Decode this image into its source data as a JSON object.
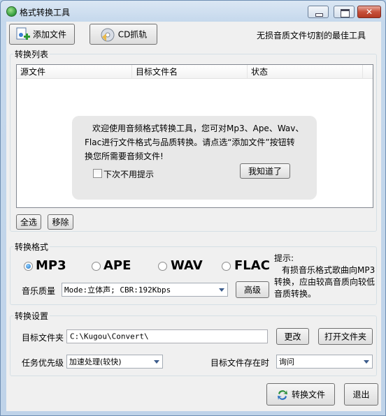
{
  "window": {
    "title": "格式转换工具"
  },
  "toolbar": {
    "add_file_label": "添加文件",
    "cd_rip_label": "CD抓轨",
    "slogan": "无损音质文件切割的最佳工具"
  },
  "convert_list": {
    "group_title": "转换列表",
    "columns": [
      "源文件",
      "目标文件名",
      "状态"
    ],
    "select_all_label": "全选",
    "remove_label": "移除"
  },
  "welcome_popup": {
    "lines": [
      "欢迎使用音频格式转换工具，您可对Mp3、Ape、Wav、",
      "Flac进行文件格式与品质转换。请点选“添加文件”按钮转",
      "换您所需要音频文件!"
    ],
    "dont_show_label": "下次不用提示",
    "dont_show_checked": false,
    "ok_label": "我知道了"
  },
  "format": {
    "group_title": "转换格式",
    "options": [
      "MP3",
      "APE",
      "WAV",
      "FLAC"
    ],
    "selected": "MP3",
    "quality_label": "音乐质量",
    "quality_value": "Mode:立体声; CBR:192Kbps",
    "advanced_label": "高级",
    "hint_title": "提示:",
    "hint_lines": [
      "有损音乐格式歌曲向MP3",
      "转换，应由较高音质向较低",
      "音质转换。"
    ]
  },
  "settings": {
    "group_title": "转换设置",
    "target_folder_label": "目标文件夹",
    "target_folder_value": "C:\\Kugou\\Convert\\",
    "change_label": "更改",
    "open_folder_label": "打开文件夹",
    "priority_label": "任务优先级",
    "priority_value": "加速处理(较快)",
    "exists_label": "目标文件存在时",
    "exists_value": "询问"
  },
  "footer": {
    "convert_label": "转换文件",
    "exit_label": "退出"
  },
  "colors": {
    "accent": "#1d6fc1",
    "close_button": "#c7513c"
  }
}
